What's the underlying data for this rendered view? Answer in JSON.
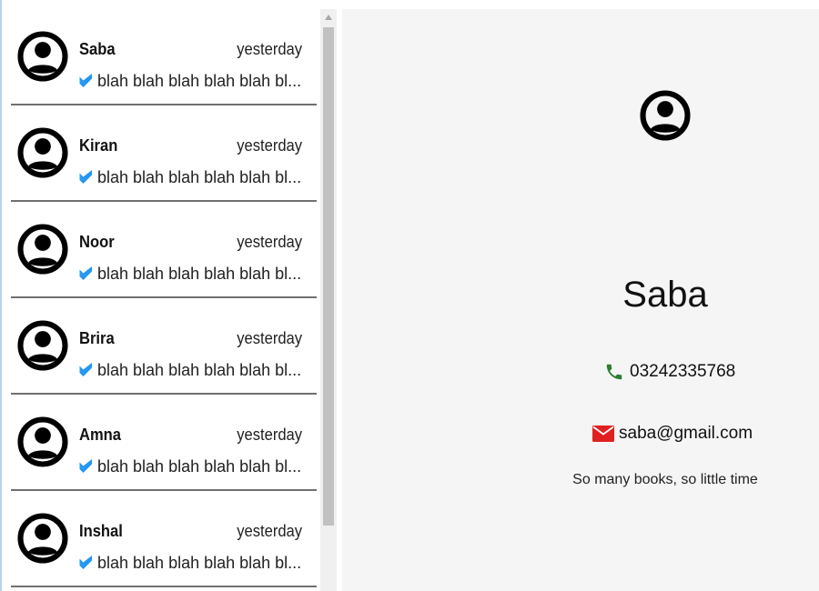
{
  "chats": [
    {
      "name": "Saba",
      "time": "yesterday",
      "preview": "blah blah blah blah blah bl...",
      "avatar_icon": "account-circle-icon",
      "status_icon": "double-check-icon"
    },
    {
      "name": "Kiran",
      "time": "yesterday",
      "preview": "blah blah blah blah blah bl...",
      "avatar_icon": "account-circle-icon",
      "status_icon": "double-check-icon"
    },
    {
      "name": "Noor",
      "time": "yesterday",
      "preview": "blah blah blah blah blah bl...",
      "avatar_icon": "account-circle-icon",
      "status_icon": "double-check-icon"
    },
    {
      "name": "Brira",
      "time": "yesterday",
      "preview": "blah blah blah blah blah bl...",
      "avatar_icon": "account-circle-icon",
      "status_icon": "double-check-icon"
    },
    {
      "name": "Amna",
      "time": "yesterday",
      "preview": "blah blah blah blah blah bl...",
      "avatar_icon": "account-circle-icon",
      "status_icon": "double-check-icon"
    },
    {
      "name": "Inshal",
      "time": "yesterday",
      "preview": "blah blah blah blah blah bl...",
      "avatar_icon": "account-circle-icon",
      "status_icon": "double-check-icon"
    }
  ],
  "details": {
    "avatar_icon": "account-circle-icon",
    "name": "Saba",
    "phone": "03242335768",
    "phone_icon": "phone-icon",
    "email": "saba@gmail.com",
    "email_icon": "mail-icon",
    "bio": "So many books, so little time"
  },
  "colors": {
    "check": "#2196f3",
    "phone": "#2e7d32",
    "mail": "#e02020",
    "panel_bg": "#f5f5f5",
    "divider": "#707070"
  }
}
